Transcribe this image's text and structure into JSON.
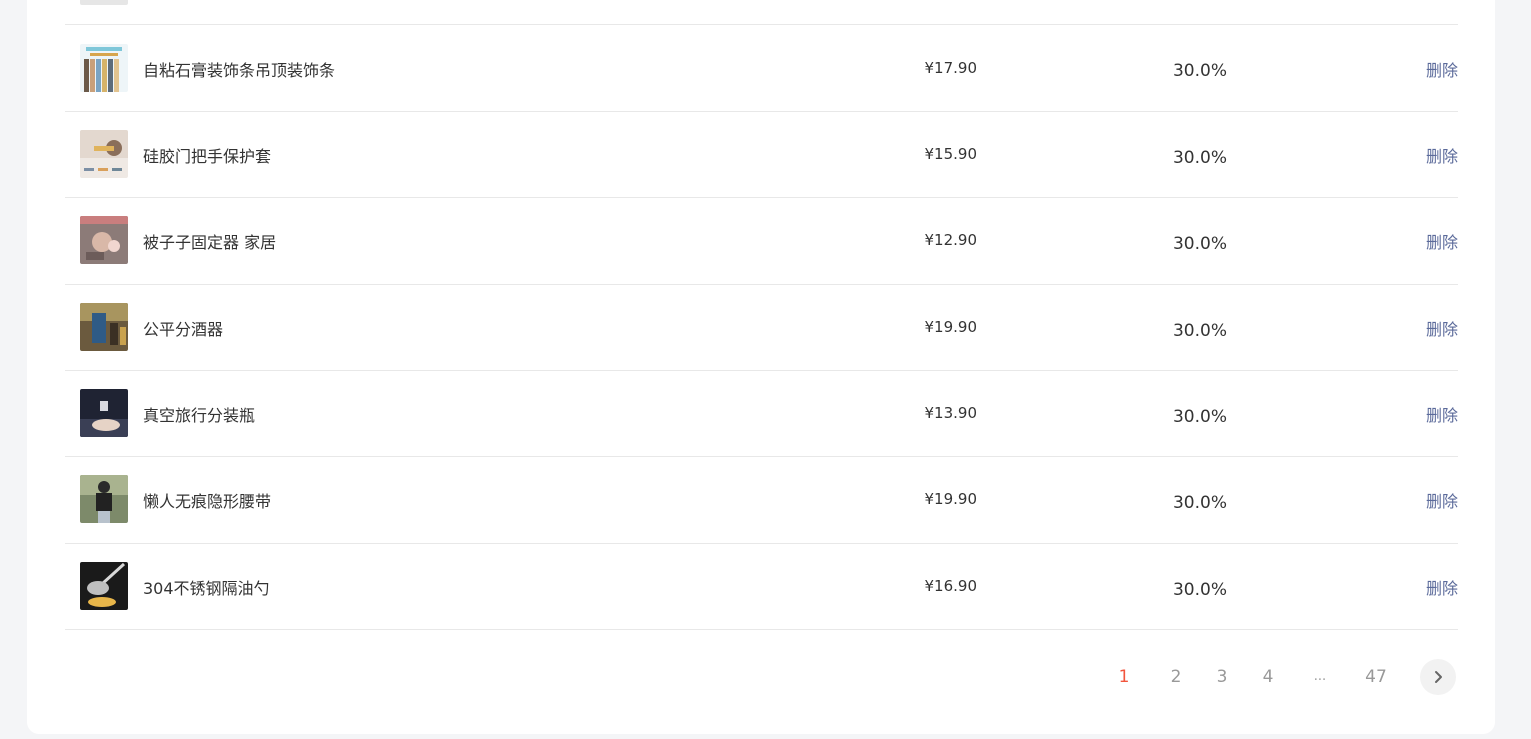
{
  "products": [
    {
      "name": "",
      "price": "",
      "rate": "",
      "action": ""
    },
    {
      "name": "自粘石膏装饰条吊顶装饰条",
      "price": "¥17.90",
      "rate": "30.0%",
      "action": "删除",
      "thumb": "decor-strip-image"
    },
    {
      "name": "硅胶门把手保护套",
      "price": "¥15.90",
      "rate": "30.0%",
      "action": "删除",
      "thumb": "door-handle-cover-image"
    },
    {
      "name": "被子子固定器 家居",
      "price": "¥12.90",
      "rate": "30.0%",
      "action": "删除",
      "thumb": "quilt-fixer-image"
    },
    {
      "name": "公平分酒器",
      "price": "¥19.90",
      "rate": "30.0%",
      "action": "删除",
      "thumb": "wine-dispenser-image"
    },
    {
      "name": "真空旅行分装瓶",
      "price": "¥13.90",
      "rate": "30.0%",
      "action": "删除",
      "thumb": "travel-bottle-image"
    },
    {
      "name": "懒人无痕隐形腰带",
      "price": "¥19.90",
      "rate": "30.0%",
      "action": "删除",
      "thumb": "invisible-belt-image"
    },
    {
      "name": "304不锈钢隔油勺",
      "price": "¥16.90",
      "rate": "30.0%",
      "action": "删除",
      "thumb": "oil-spoon-image"
    }
  ],
  "pagination": {
    "pages": [
      "1",
      "2",
      "3",
      "4",
      "...",
      "47"
    ],
    "current": "1",
    "next_icon": "chevron-right-icon",
    "active_color": "#f2553d"
  },
  "colors": {
    "action_link": "#5b6a9a",
    "text": "#333333",
    "divider": "#e8e8e8"
  }
}
